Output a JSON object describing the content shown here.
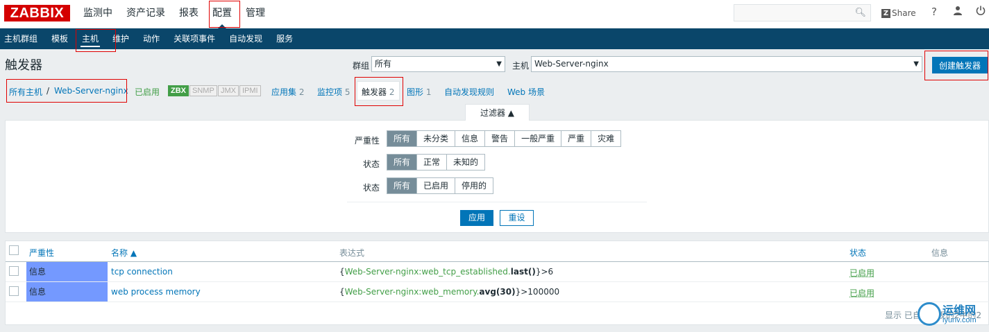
{
  "logo": "ZABBIX",
  "top_menu": [
    {
      "label": "监测中"
    },
    {
      "label": "资产记录"
    },
    {
      "label": "报表"
    },
    {
      "label": "配置"
    },
    {
      "label": "管理"
    }
  ],
  "search": {
    "placeholder": ""
  },
  "share_label": "Share",
  "sub_menu": [
    {
      "label": "主机群组"
    },
    {
      "label": "模板"
    },
    {
      "label": "主机"
    },
    {
      "label": "维护"
    },
    {
      "label": "动作"
    },
    {
      "label": "关联项事件"
    },
    {
      "label": "自动发现"
    },
    {
      "label": "服务"
    }
  ],
  "header": {
    "title": "触发器",
    "group_label": "群组",
    "group_value": "所有",
    "host_label": "主机",
    "host_value": "Web-Server-nginx",
    "create_button": "创建触发器"
  },
  "breadcrumb": {
    "all_hosts": "所有主机",
    "separator": "/",
    "host": "Web-Server-nginx",
    "enabled": "已启用",
    "badges": [
      "ZBX",
      "SNMP",
      "JMX",
      "IPMI"
    ],
    "tabs": [
      {
        "label": "应用集",
        "count": "2"
      },
      {
        "label": "监控项",
        "count": "5"
      },
      {
        "label": "触发器",
        "count": "2"
      },
      {
        "label": "图形",
        "count": "1"
      },
      {
        "label": "自动发现规则",
        "count": ""
      },
      {
        "label": "Web 场景",
        "count": ""
      }
    ]
  },
  "filter": {
    "tab_label": "过滤器 ▲",
    "severity_label": "严重性",
    "severity_options": [
      "所有",
      "未分类",
      "信息",
      "警告",
      "一般严重",
      "严重",
      "灾难"
    ],
    "state_label": "状态",
    "state_options": [
      "所有",
      "正常",
      "未知的"
    ],
    "status_label": "状态",
    "status_options": [
      "所有",
      "已启用",
      "停用的"
    ],
    "apply": "应用",
    "reset": "重设"
  },
  "table": {
    "headers": {
      "severity": "严重性",
      "name": "名称 ▲",
      "expression": "表达式",
      "status": "状态",
      "info": "信息"
    },
    "rows": [
      {
        "severity": "信息",
        "name": "tcp connection",
        "expr_open": "{",
        "expr_host": "Web-Server-nginx:web_tcp_established.",
        "expr_fn": "last()",
        "expr_close": "}>6",
        "status": "已启用"
      },
      {
        "severity": "信息",
        "name": "web process memory",
        "expr_open": "{",
        "expr_host": "Web-Server-nginx:web_memory.",
        "expr_fn": "avg(30)",
        "expr_close": "}>100000",
        "status": "已启用"
      }
    ],
    "footer": "显示 已自动发现的2中的2"
  },
  "watermark": {
    "cn": "运维网",
    "url": "iyunv.com"
  },
  "colors": {
    "brand_red": "#d40000",
    "nav_blue": "#0a466a",
    "link_blue": "#0275b8",
    "enabled_green": "#429e47",
    "severity_info": "#7499ff"
  }
}
